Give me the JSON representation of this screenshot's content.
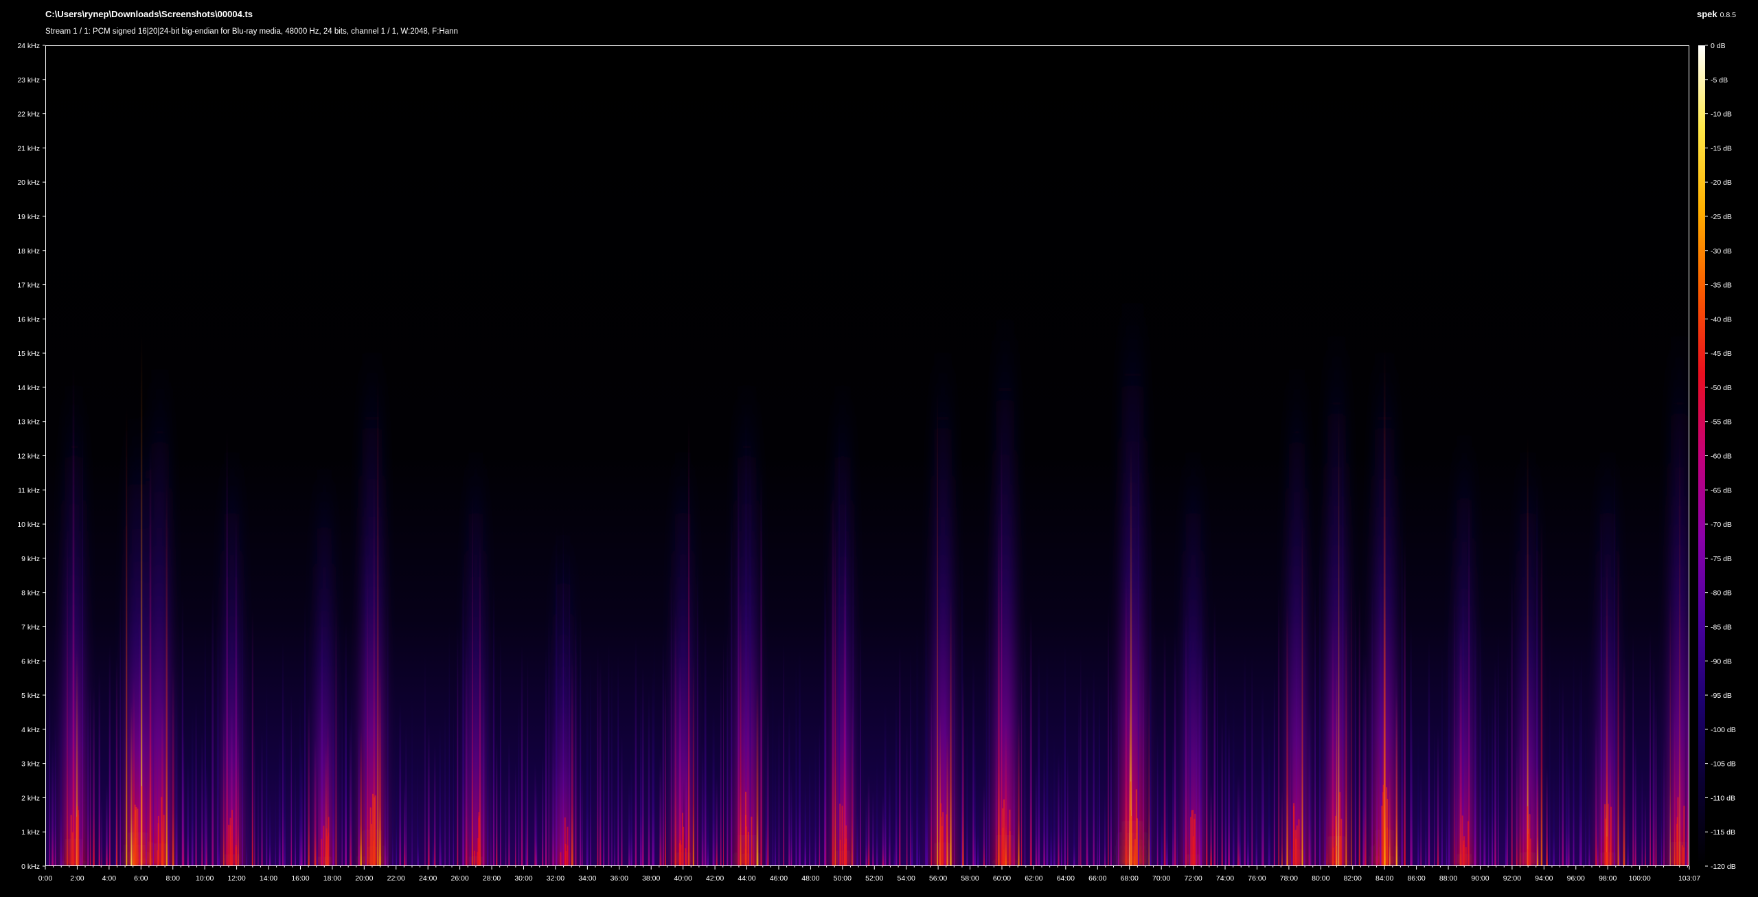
{
  "header": {
    "file_path": "C:\\Users\\rynep\\Downloads\\Screenshots\\00004.ts",
    "stream_info": "Stream 1 / 1: PCM signed 16|20|24-bit big-endian for Blu-ray media, 48000 Hz, 24 bits, channel 1 / 1, W:2048, F:Hann",
    "app_name": "spek",
    "app_version": "0.8.5"
  },
  "chart_data": {
    "type": "heatmap",
    "title": "",
    "xlabel": "",
    "ylabel": "",
    "x_unit": "minutes",
    "y_unit": "kHz",
    "xlim": [
      0,
      103.1167
    ],
    "ylim": [
      0,
      24
    ],
    "x_tick_labels": [
      "0:00",
      "2:00",
      "4:00",
      "6:00",
      "8:00",
      "10:00",
      "12:00",
      "14:00",
      "16:00",
      "18:00",
      "20:00",
      "22:00",
      "24:00",
      "26:00",
      "28:00",
      "30:00",
      "32:00",
      "34:00",
      "36:00",
      "38:00",
      "40:00",
      "42:00",
      "44:00",
      "46:00",
      "48:00",
      "50:00",
      "52:00",
      "54:00",
      "56:00",
      "58:00",
      "60:00",
      "62:00",
      "64:00",
      "66:00",
      "68:00",
      "70:00",
      "72:00",
      "74:00",
      "76:00",
      "78:00",
      "80:00",
      "82:00",
      "84:00",
      "86:00",
      "88:00",
      "90:00",
      "92:00",
      "94:00",
      "96:00",
      "98:00",
      "100:00",
      "103:07"
    ],
    "x_tick_minutes": [
      0,
      2,
      4,
      6,
      8,
      10,
      12,
      14,
      16,
      18,
      20,
      22,
      24,
      26,
      28,
      30,
      32,
      34,
      36,
      38,
      40,
      42,
      44,
      46,
      48,
      50,
      52,
      54,
      56,
      58,
      60,
      62,
      64,
      66,
      68,
      70,
      72,
      74,
      76,
      78,
      80,
      82,
      84,
      86,
      88,
      90,
      92,
      94,
      96,
      98,
      100,
      103.1167
    ],
    "y_tick_labels": [
      "0 kHz",
      "1 kHz",
      "2 kHz",
      "3 kHz",
      "4 kHz",
      "5 kHz",
      "6 kHz",
      "7 kHz",
      "8 kHz",
      "9 kHz",
      "10 kHz",
      "11 kHz",
      "12 kHz",
      "13 kHz",
      "14 kHz",
      "15 kHz",
      "16 kHz",
      "17 kHz",
      "18 kHz",
      "19 kHz",
      "20 kHz",
      "21 kHz",
      "22 kHz",
      "23 kHz",
      "24 kHz"
    ],
    "y_tick_khz": [
      0,
      1,
      2,
      3,
      4,
      5,
      6,
      7,
      8,
      9,
      10,
      11,
      12,
      13,
      14,
      15,
      16,
      17,
      18,
      19,
      20,
      21,
      22,
      23,
      24
    ],
    "colorbar": {
      "labels": [
        "0 dB",
        "-5 dB",
        "-10 dB",
        "-15 dB",
        "-20 dB",
        "-25 dB",
        "-30 dB",
        "-35 dB",
        "-40 dB",
        "-45 dB",
        "-50 dB",
        "-55 dB",
        "-60 dB",
        "-65 dB",
        "-70 dB",
        "-75 dB",
        "-80 dB",
        "-85 dB",
        "-90 dB",
        "-95 dB",
        "-100 dB",
        "-105 dB",
        "-110 dB",
        "-115 dB",
        "-120 dB"
      ],
      "db_values": [
        0,
        -5,
        -10,
        -15,
        -20,
        -25,
        -30,
        -35,
        -40,
        -45,
        -50,
        -55,
        -60,
        -65,
        -70,
        -75,
        -80,
        -85,
        -90,
        -95,
        -100,
        -105,
        -110,
        -115,
        -120
      ],
      "range_db": [
        -120,
        0
      ],
      "colors": [
        "#000000",
        "#0a0030",
        "#1c006e",
        "#4a00a0",
        "#8a00a8",
        "#c4007a",
        "#ea0f1f",
        "#fa5a00",
        "#ffb000",
        "#ffe84a",
        "#ffffff"
      ]
    },
    "energy_peaks": [
      {
        "t": 1.8,
        "top_khz": 14.5,
        "level": 0.75
      },
      {
        "t": 5.8,
        "top_khz": 13.5,
        "level": 0.9
      },
      {
        "t": 7.2,
        "top_khz": 15.0,
        "level": 0.7
      },
      {
        "t": 11.7,
        "top_khz": 12.5,
        "level": 0.55
      },
      {
        "t": 17.5,
        "top_khz": 12.0,
        "level": 0.5
      },
      {
        "t": 20.5,
        "top_khz": 15.5,
        "level": 0.85
      },
      {
        "t": 27.0,
        "top_khz": 12.5,
        "level": 0.5
      },
      {
        "t": 32.5,
        "top_khz": 10.0,
        "level": 0.45
      },
      {
        "t": 40.0,
        "top_khz": 12.5,
        "level": 0.6
      },
      {
        "t": 44.0,
        "top_khz": 14.5,
        "level": 0.8
      },
      {
        "t": 50.0,
        "top_khz": 14.5,
        "level": 0.6
      },
      {
        "t": 56.3,
        "top_khz": 15.5,
        "level": 0.7
      },
      {
        "t": 60.2,
        "top_khz": 16.5,
        "level": 0.75
      },
      {
        "t": 68.2,
        "top_khz": 17.0,
        "level": 1.0
      },
      {
        "t": 72.0,
        "top_khz": 12.5,
        "level": 0.55
      },
      {
        "t": 78.5,
        "top_khz": 15.0,
        "level": 0.6
      },
      {
        "t": 81.0,
        "top_khz": 16.0,
        "level": 0.75
      },
      {
        "t": 84.0,
        "top_khz": 15.5,
        "level": 0.85
      },
      {
        "t": 89.0,
        "top_khz": 13.0,
        "level": 0.55
      },
      {
        "t": 93.0,
        "top_khz": 12.5,
        "level": 0.6
      },
      {
        "t": 98.0,
        "top_khz": 12.5,
        "level": 0.6
      },
      {
        "t": 102.5,
        "top_khz": 16.0,
        "level": 0.7
      }
    ]
  }
}
